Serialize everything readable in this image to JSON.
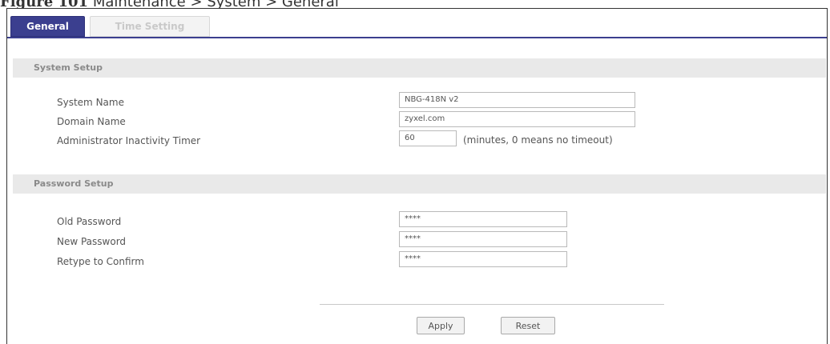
{
  "figure_caption": {
    "number": "Figure 101",
    "text": "Maintenance > System > General"
  },
  "tabs": [
    {
      "label": "General",
      "active": true
    },
    {
      "label": "Time Setting",
      "active": false
    }
  ],
  "system_setup": {
    "heading": "System Setup",
    "system_name_label": "System Name",
    "system_name_value": "NBG-418N v2",
    "domain_name_label": "Domain Name",
    "domain_name_value": "zyxel.com",
    "inactivity_label": "Administrator Inactivity Timer",
    "inactivity_value": "60",
    "inactivity_note": "(minutes, 0 means no timeout)"
  },
  "password_setup": {
    "heading": "Password Setup",
    "old_label": "Old Password",
    "old_value": "****",
    "new_label": "New Password",
    "new_value": "****",
    "retype_label": "Retype to Confirm",
    "retype_value": "****"
  },
  "buttons": {
    "apply": "Apply",
    "reset": "Reset"
  },
  "colors": {
    "tab_active": "#3b3f8f",
    "section_bg": "#e9e9e9",
    "section_text": "#8a8a8a"
  }
}
